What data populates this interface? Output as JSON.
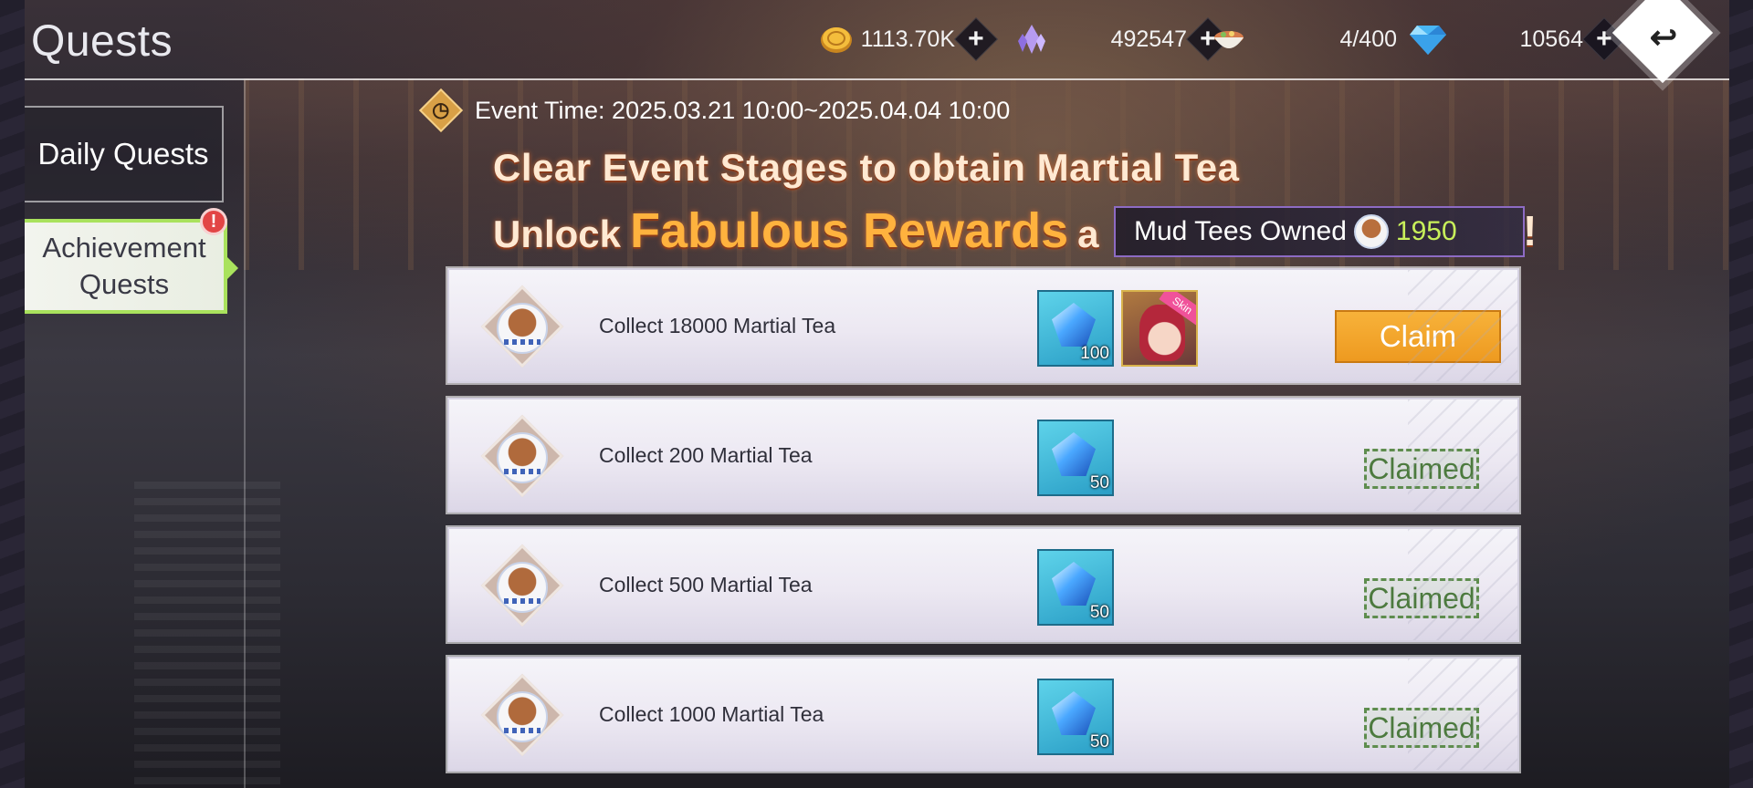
{
  "header": {
    "title": "Quests",
    "back_icon": "back-arrow-icon"
  },
  "resources": [
    {
      "name": "gold",
      "icon": "gold-coin-icon",
      "value": "1113.70K",
      "has_plus": true
    },
    {
      "name": "crystal",
      "icon": "purple-crystal-icon",
      "value": "492547",
      "has_plus": true
    },
    {
      "name": "stamina",
      "icon": "food-bowl-icon",
      "value": "4/400",
      "has_plus": false
    },
    {
      "name": "diamond",
      "icon": "blue-diamond-icon",
      "value": "10564",
      "has_plus": true
    }
  ],
  "sidebar": {
    "tabs": [
      {
        "label": "Daily Quests",
        "active": false
      },
      {
        "label_line1": "Achievement",
        "label_line2": "Quests",
        "active": true,
        "alert": "!"
      }
    ]
  },
  "event": {
    "time_text": "Event Time: 2025.03.21 10:00~2025.04.04 10:00",
    "headline_line1": "Clear Event Stages to obtain Martial Tea",
    "headline_line2_prefix": "Unlock",
    "headline_line2_highlight": "Fabulous Rewards",
    "headline_line2_suffix": "a",
    "headline_bang": "!",
    "owned_label": "Mud Tees Owned",
    "owned_value": "1950"
  },
  "quests": [
    {
      "desc": "Collect 18000 Martial Tea",
      "rewards": [
        {
          "type": "diamond",
          "qty": "100"
        },
        {
          "type": "skin",
          "tag": "Skin"
        }
      ],
      "status": "Claim"
    },
    {
      "desc": "Collect 200 Martial Tea",
      "rewards": [
        {
          "type": "diamond",
          "qty": "50"
        }
      ],
      "status": "Claimed"
    },
    {
      "desc": "Collect 500 Martial Tea",
      "rewards": [
        {
          "type": "diamond",
          "qty": "50"
        }
      ],
      "status": "Claimed"
    },
    {
      "desc": "Collect 1000 Martial Tea",
      "rewards": [
        {
          "type": "diamond",
          "qty": "50"
        }
      ],
      "status": "Claimed"
    }
  ],
  "colors": {
    "accent_green": "#a9e25d",
    "claim_orange": "#f5a42c",
    "claimed_green": "#4c7a3e",
    "owned_value": "#c8f05a",
    "headline_highlight": "#ffb23e"
  }
}
